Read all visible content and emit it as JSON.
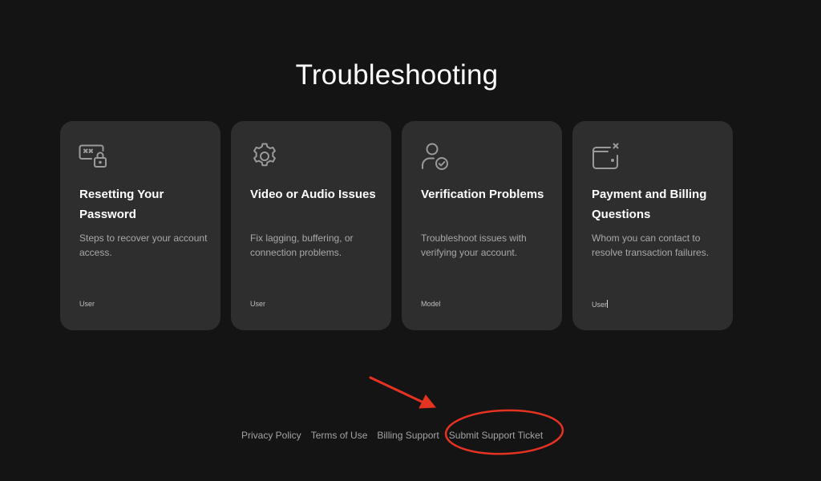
{
  "page": {
    "title": "Troubleshooting"
  },
  "cards": [
    {
      "icon": "password-lock-icon",
      "title": "Resetting Your Password",
      "description": "Steps to recover your account access.",
      "tag": "User"
    },
    {
      "icon": "gear-icon",
      "title": "Video or Audio Issues",
      "description": "Fix lagging, buffering, or connection problems.",
      "tag": "User"
    },
    {
      "icon": "user-check-icon",
      "title": "Verification Problems",
      "description": "Troubleshoot issues with verifying your account.",
      "tag": "Model"
    },
    {
      "icon": "wallet-x-icon",
      "title": "Payment and Billing Questions",
      "description": "Whom you can contact to resolve transaction failures.",
      "tag": "User"
    }
  ],
  "footer": {
    "links": [
      "Privacy Policy",
      "Terms of Use",
      "Billing Support",
      "Submit Support Ticket"
    ]
  },
  "colors": {
    "background": "#141414",
    "card": "#2e2e2e",
    "annotation": "#e53322"
  }
}
